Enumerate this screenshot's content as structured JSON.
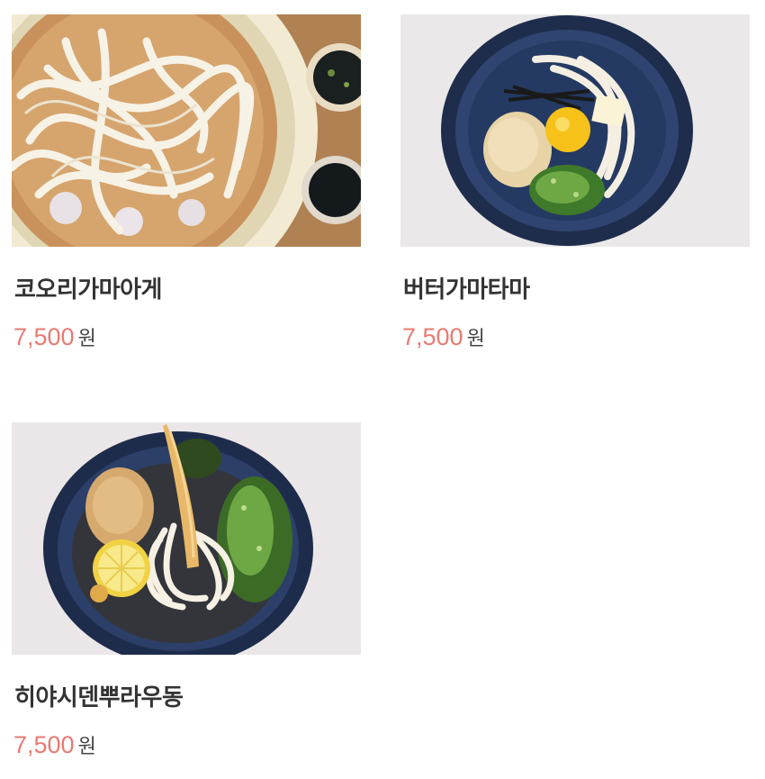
{
  "menu": {
    "items": [
      {
        "name": "코오리가마아게",
        "price": "7,500",
        "unit": "원",
        "image": "cold-udon-on-ice-photo"
      },
      {
        "name": "버터가마타마",
        "price": "7,500",
        "unit": "원",
        "image": "butter-egg-udon-photo"
      },
      {
        "name": "히야시덴뿌라우동",
        "price": "7,500",
        "unit": "원",
        "image": "cold-tempura-udon-photo"
      }
    ]
  },
  "colors": {
    "price": "#e97a72",
    "name": "#333333",
    "unit": "#444444"
  }
}
